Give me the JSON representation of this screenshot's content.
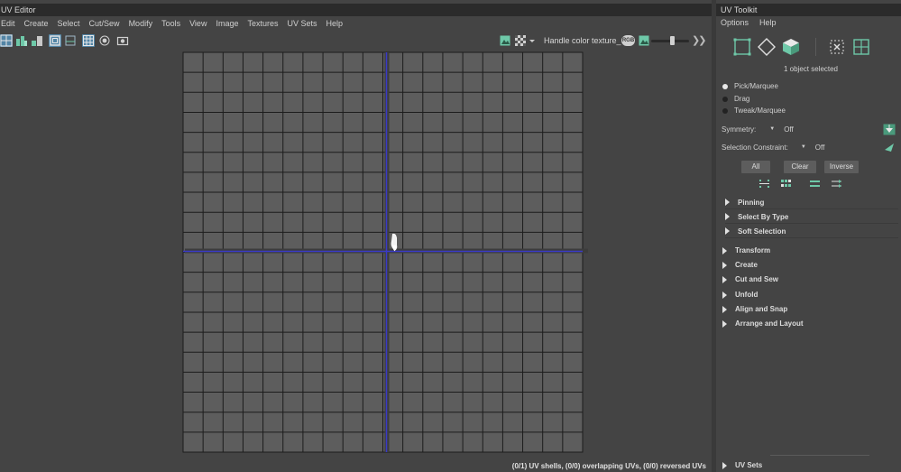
{
  "uv_editor": {
    "title": "UV Editor",
    "menu": [
      "Edit",
      "Create",
      "Select",
      "Cut/Sew",
      "Modify",
      "Tools",
      "View",
      "Image",
      "Textures",
      "UV Sets",
      "Help"
    ],
    "handle_color_label": "Handle color texture_",
    "rgb_badge": "RGB",
    "exposure_value": 0.55,
    "status": "(0/1) UV shells, (0/0) overlapping UVs, (0/0) reversed UVs"
  },
  "uv_toolkit": {
    "title": "UV Toolkit",
    "menu": [
      "Options",
      "Help"
    ],
    "object_selected": "1 object selected",
    "tools": [
      {
        "label": "Pick/Marquee",
        "selected": true
      },
      {
        "label": "Drag",
        "selected": false
      },
      {
        "label": "Tweak/Marquee",
        "selected": false
      }
    ],
    "symmetry_label": "Symmetry:",
    "symmetry_value": "Off",
    "constraint_label": "Selection Constraint:",
    "constraint_value": "Off",
    "buttons": {
      "all": "All",
      "clear": "Clear",
      "inverse": "Inverse"
    },
    "subsections": [
      "Pinning",
      "Select By Type",
      "Soft Selection"
    ],
    "sections": [
      "Transform",
      "Create",
      "Cut and Sew",
      "Unfold",
      "Align and Snap",
      "Arrange and Layout"
    ],
    "uv_sets": "UV Sets"
  },
  "colors": {
    "panel_bg": "#444444",
    "grid_bg": "#5d5d5d",
    "grid_line": "#1c1c1c",
    "axis_blue": "#3a3ac8",
    "accent_blue": "#5285a6",
    "icon_green": "#6ec8a8"
  }
}
